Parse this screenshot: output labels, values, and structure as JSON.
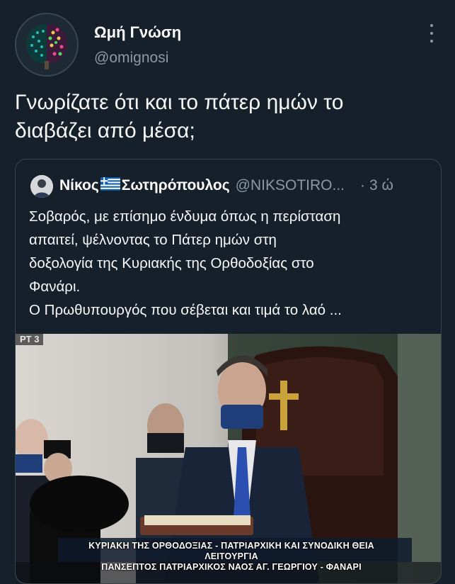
{
  "author": {
    "name": "Ωμή Γνώση",
    "handle": "@omignosi",
    "avatar_icon": "brain-avatar-icon"
  },
  "tweet": {
    "text_line1": "Γνωρίζατε ότι και το πάτερ ημών το",
    "text_line2": "διαβάζει από μέσα;"
  },
  "quote": {
    "name_part1": "Νίκος",
    "flag_icon": "greek-flag-icon",
    "name_part2": "Σωτηρόπουλος",
    "handle": "@NIKSOTIRO...",
    "dot": "·",
    "time": "3 ώ",
    "lines": [
      "Σοβαρός, με επίσημο ένδυμα όπως η περίσταση",
      "απαιτεί, ψέλνοντας το Πάτερ ημών στη",
      "δοξολογία της Κυριακής της Ορθοδοξίας στο",
      "Φανάρι.",
      "Ο Πρωθυπουργός που σέβεται και τιμά το λαό ..."
    ],
    "media": {
      "channel_logo": "ΡΤ 3",
      "caption_line1": "ΚΥΡΙΑΚΗ ΤΗΣ ΟΡΘΟΔΟΞΙΑΣ - ΠΑΤΡΙΑΡΧΙΚΗ ΚΑΙ ΣΥΝΟΔΙΚΗ ΘΕΙΑ ΛΕΙΤΟΥΡΓΙΑ",
      "caption_line2": "ΠΑΝΣΕΠΤΟΣ ΠΑΤΡΙΑΡΧΙΚΟΣ ΝΑΟΣ ΑΓ. ΓΕΩΡΓΙΟΥ - ΦΑΝΑΡΙ"
    }
  },
  "colors": {
    "background": "#15202b",
    "secondary_text": "#8b98a5",
    "border": "#38444d"
  }
}
